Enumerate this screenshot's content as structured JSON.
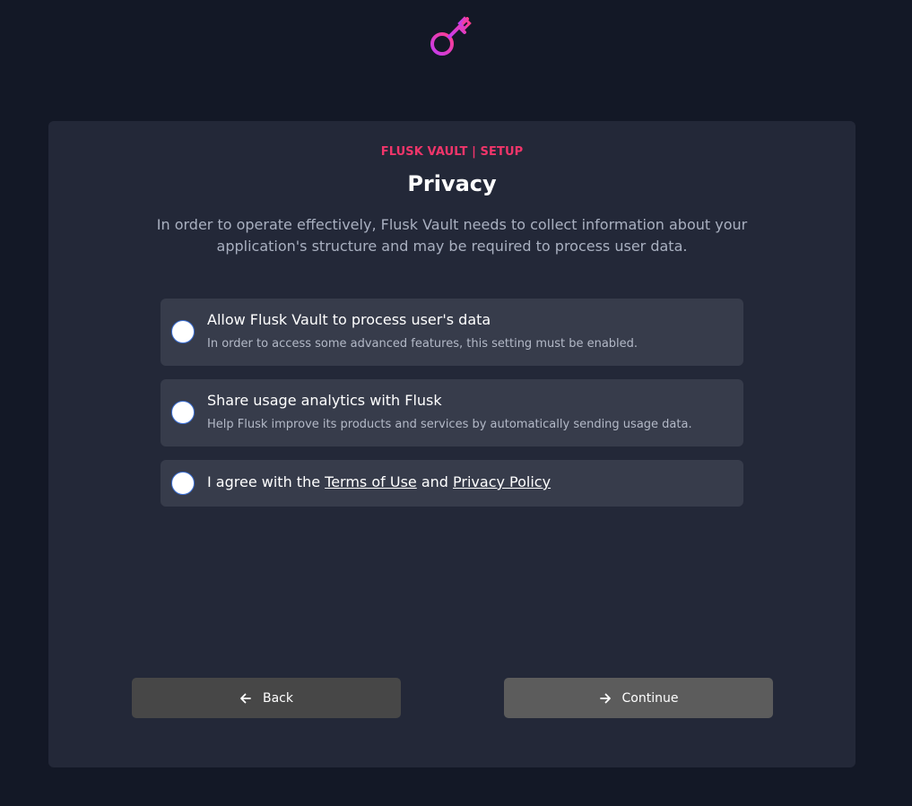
{
  "logo": {
    "icon": "key-icon",
    "colors": [
      "#ff3d8b",
      "#c33cf0"
    ]
  },
  "header": {
    "eyebrow": "FLUSK VAULT | SETUP",
    "title": "Privacy",
    "description": "In order to operate effectively, Flusk Vault needs to collect information about your application's structure and may be required to process user data."
  },
  "options": [
    {
      "title": "Allow Flusk Vault to process user's data",
      "subtitle": "In order to access some advanced features, this setting must be enabled.",
      "checked": false
    },
    {
      "title": "Share usage analytics with Flusk",
      "subtitle": "Help Flusk improve its products and services by automatically sending usage data.",
      "checked": false
    }
  ],
  "agreement": {
    "prefix": "I agree with the ",
    "terms_link": "Terms of Use",
    "middle": " and ",
    "privacy_link": "Privacy Policy",
    "checked": false
  },
  "buttons": {
    "back_label": "Back",
    "back_icon": "arrow-left-icon",
    "continue_label": "Continue",
    "continue_icon": "arrow-right-icon"
  },
  "colors": {
    "accent": "#f0356a",
    "background": "#131826",
    "card": "#232838",
    "option": "#373c4b",
    "radio_border": "#3b6fd4"
  }
}
